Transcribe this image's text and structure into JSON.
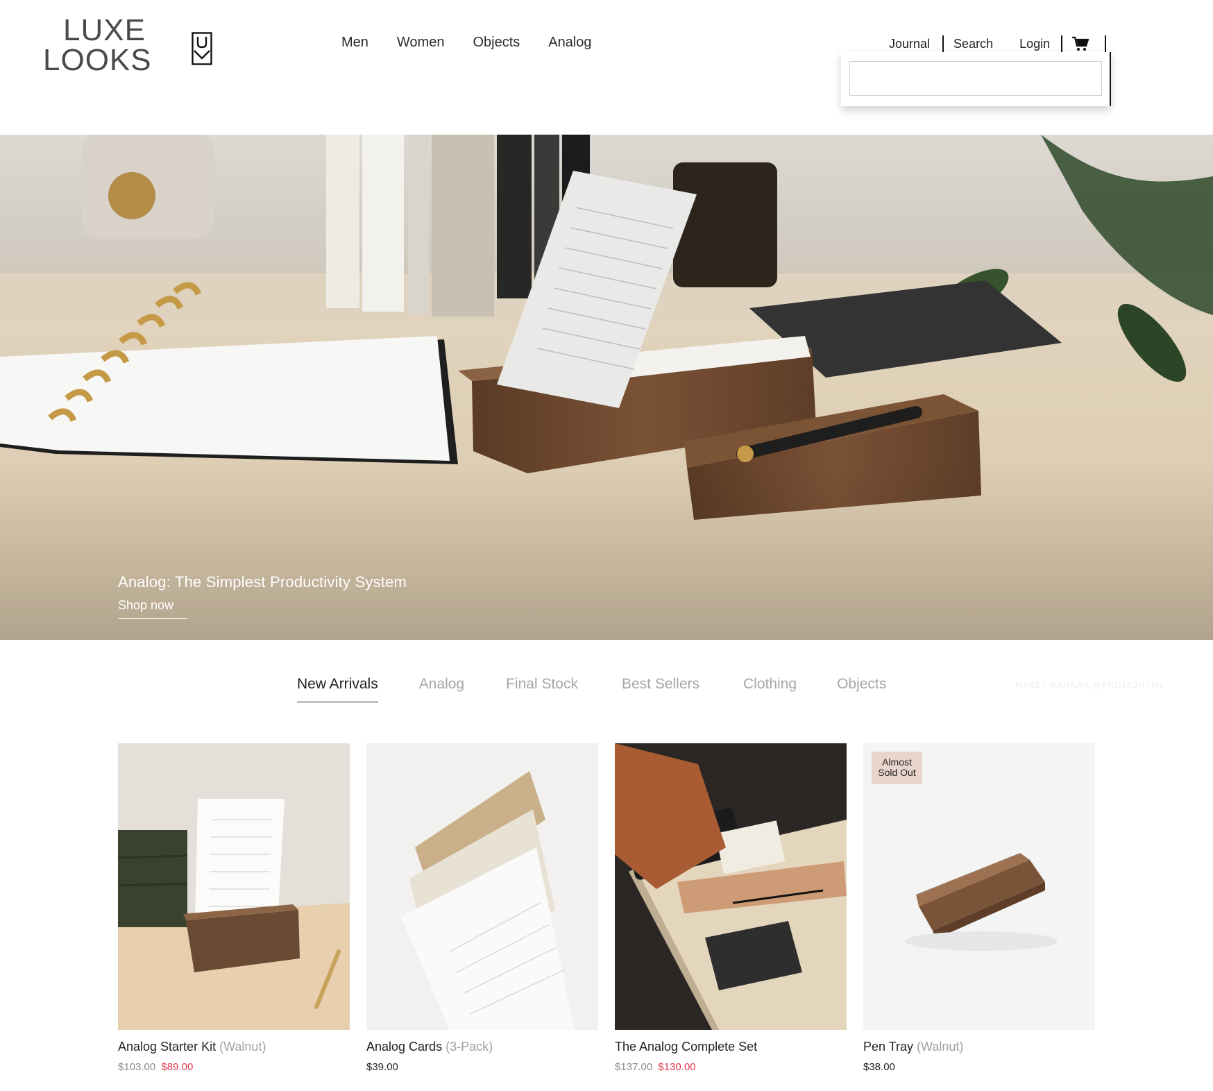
{
  "brand": {
    "line1": "LUXE",
    "line2": "LOOKS"
  },
  "nav": [
    "Men",
    "Women",
    "Objects",
    "Analog"
  ],
  "util": {
    "journal": "Journal",
    "search": "Search",
    "login": "Login"
  },
  "search": {
    "value": "",
    "placeholder": ""
  },
  "hero": {
    "title": "Analog: The Simplest Productivity System",
    "cta": "Shop now"
  },
  "tabs": [
    "New Arrivals",
    "Analog",
    "Final Stock",
    "Best Sellers",
    "Clothing",
    "Objects"
  ],
  "active_tab": "New Arrivals",
  "watermark": "МАКЕТ КАНАЛА @FIGMA2HTML",
  "products": [
    {
      "name": "Analog Starter Kit",
      "variant": "(Walnut)",
      "original_price": "$103.00",
      "sale_price": "$89.00",
      "badge": ""
    },
    {
      "name": "Analog Cards",
      "variant": "(3-Pack)",
      "original_price": "$39.00",
      "sale_price": "",
      "badge": ""
    },
    {
      "name": "The Analog Complete Set",
      "variant": "",
      "original_price": "$137.00",
      "sale_price": "$130.00",
      "badge": ""
    },
    {
      "name": "Pen Tray",
      "variant": "(Walnut)",
      "original_price": "$38.00",
      "sale_price": "",
      "badge_line1": "Almost",
      "badge_line2": "Sold Out"
    }
  ],
  "colors": {
    "sale": "#e23a4a",
    "badge_bg": "#ead5cd",
    "walnut": "#6b4a33"
  },
  "icons": {
    "cart": "cart-icon",
    "logo_mark": "u-chevron-logo-icon"
  }
}
